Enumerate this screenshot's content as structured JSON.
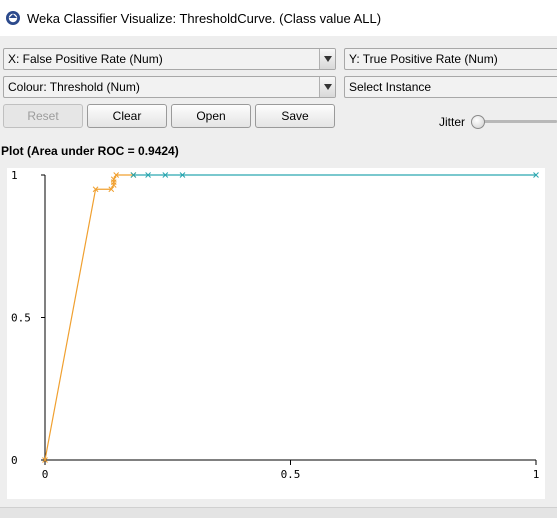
{
  "window": {
    "title": "Weka Classifier Visualize: ThresholdCurve. (Class value ALL)"
  },
  "controls": {
    "x_axis": "X: False Positive Rate (Num)",
    "y_axis": "Y: True Positive Rate (Num)",
    "colour": "Colour: Threshold (Num)",
    "select_instance": "Select Instance",
    "reset": "Reset",
    "clear": "Clear",
    "open": "Open",
    "save": "Save",
    "jitter_label": "Jitter",
    "jitter_value": 0
  },
  "plot": {
    "title": "Plot (Area under ROC = 0.9424)",
    "colors": {
      "low_threshold": "#2aa6b0",
      "high_threshold": "#f0a030"
    }
  },
  "chart_data": {
    "type": "line",
    "xlabel": "",
    "ylabel": "",
    "xlim": [
      0,
      1
    ],
    "ylim": [
      0,
      1
    ],
    "x_ticks": [
      "0",
      "0.5",
      "1"
    ],
    "y_ticks": [
      "0",
      "0.5",
      "1"
    ],
    "series": [
      {
        "color": "#f0a030",
        "points": [
          [
            0.0,
            0.0
          ],
          [
            0.103,
            0.95
          ],
          [
            0.135,
            0.95
          ],
          [
            0.14,
            0.965
          ],
          [
            0.14,
            0.975
          ],
          [
            0.14,
            0.985
          ],
          [
            0.145,
            1.0
          ],
          [
            0.18,
            1.0
          ]
        ]
      },
      {
        "color": "#2aa6b0",
        "points": [
          [
            0.18,
            1.0
          ],
          [
            0.21,
            1.0
          ],
          [
            0.245,
            1.0
          ],
          [
            0.28,
            1.0
          ],
          [
            1.0,
            1.0
          ]
        ]
      }
    ]
  }
}
